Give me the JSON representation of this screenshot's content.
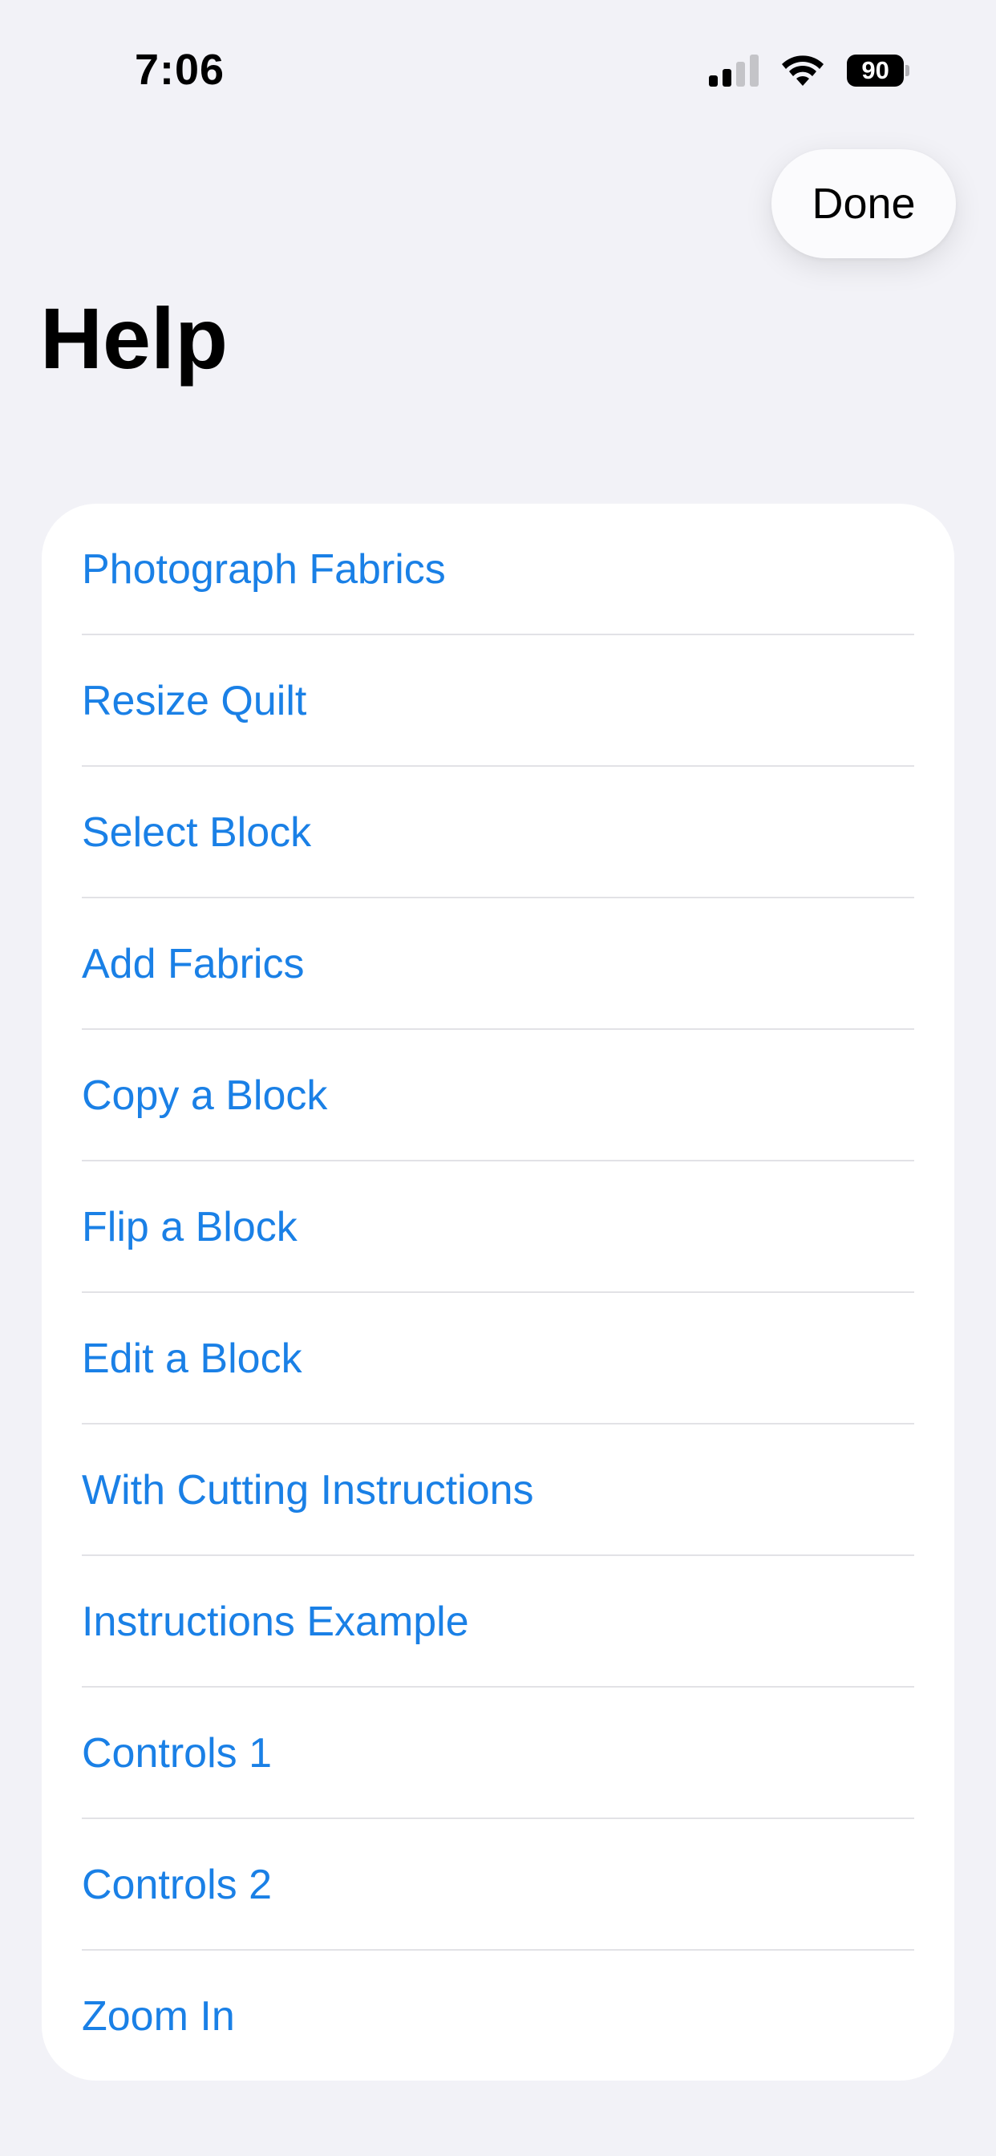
{
  "status_bar": {
    "time": "7:06",
    "battery": "90"
  },
  "header": {
    "done_label": "Done",
    "title": "Help"
  },
  "help_items": [
    "Photograph Fabrics",
    "Resize Quilt",
    "Select Block",
    "Add Fabrics",
    "Copy a Block",
    "Flip a Block",
    "Edit a Block",
    "With Cutting Instructions",
    "Instructions Example",
    "Controls 1",
    "Controls 2",
    "Zoom In"
  ],
  "colors": {
    "background": "#f2f2f7",
    "link": "#1a80e6",
    "card": "#ffffff"
  }
}
